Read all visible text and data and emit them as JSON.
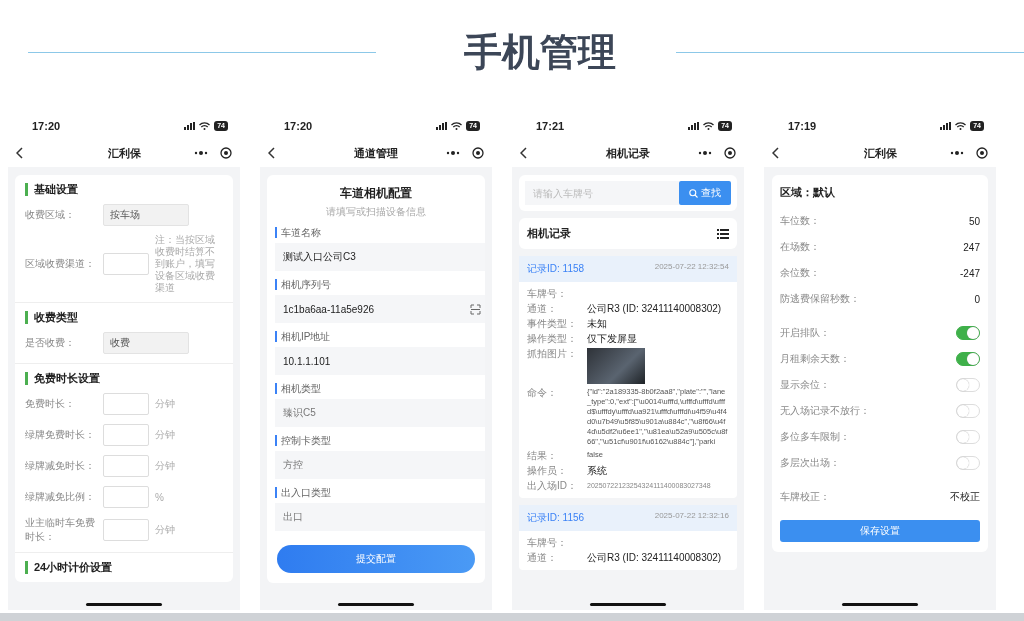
{
  "title": "手机管理",
  "phones": [
    {
      "kind": "fee_settings",
      "time": "17:20",
      "battery": "74",
      "nav_title": "汇利保",
      "sections": [
        {
          "title": "基础设置",
          "rows": [
            {
              "kind": "select",
              "label": "收费区域：",
              "value": "按车场"
            },
            {
              "kind": "input",
              "label": "区域收费渠道：",
              "note": "注：当按区域收费时结算不到账户，填写设备区域收费渠道"
            }
          ]
        },
        {
          "title": "收费类型",
          "rows": [
            {
              "kind": "select",
              "label": "是否收费：",
              "value": "收费"
            }
          ]
        },
        {
          "title": "免费时长设置",
          "rows": [
            {
              "kind": "input",
              "label": "免费时长：",
              "unit": "分钟"
            },
            {
              "kind": "input",
              "label": "绿牌免费时长：",
              "unit": "分钟"
            },
            {
              "kind": "input",
              "label": "绿牌减免时长：",
              "unit": "分钟"
            },
            {
              "kind": "input",
              "label": "绿牌减免比例：",
              "unit": "%"
            },
            {
              "kind": "input",
              "label": "业主临时车免费时长：",
              "unit": "分钟"
            }
          ]
        },
        {
          "title": "24小时计价设置"
        }
      ]
    },
    {
      "kind": "lane_camera_form",
      "time": "17:20",
      "battery": "74",
      "nav_title": "通道管理",
      "heading": "车道相机配置",
      "subheading": "请填写或扫描设备信息",
      "fields": [
        {
          "kind": "text",
          "label": "车道名称",
          "value": "测试入口公司C3"
        },
        {
          "kind": "scan",
          "label": "相机序列号",
          "value": "1c1ba6aa-11a5e926"
        },
        {
          "kind": "text",
          "label": "相机IP地址",
          "value": "10.1.1.101"
        },
        {
          "kind": "picker",
          "label": "相机类型",
          "value": "臻识C5"
        },
        {
          "kind": "picker",
          "label": "控制卡类型",
          "value": "方控"
        },
        {
          "kind": "picker",
          "label": "出入口类型",
          "value": "出口"
        }
      ],
      "button": "提交配置"
    },
    {
      "kind": "camera_records",
      "time": "17:21",
      "battery": "74",
      "nav_title": "相机记录",
      "search": {
        "placeholder": "请输入车牌号",
        "button": "查找"
      },
      "list_title": "相机记录",
      "records": [
        {
          "id": "记录ID: 1158",
          "time": "2025-07-22 12:32:54",
          "fields": [
            {
              "kind": "text",
              "label": "车牌号："
            },
            {
              "kind": "text",
              "label": "通道：",
              "value": "公司R3 (ID: 32411140008302)"
            },
            {
              "kind": "text",
              "label": "事件类型：",
              "value": "未知"
            },
            {
              "kind": "text",
              "label": "操作类型：",
              "value": "仅下发屏显"
            },
            {
              "kind": "photo",
              "label": "抓拍图片："
            },
            {
              "kind": "code",
              "label": "命令：",
              "value": "{\"id\":\"2a189335-8b0f2aa8\",\"plate\":\"\",\"lane_type\":0,\"ext\":[\"\\u0014\\ufffd,\\ufffd\\ufffd\\ufffd$\\ufffdy\\ufffd\\ua921\\ufffd\\ufffdi\\u4f59\\u4f4d0\\u7b49\\u5f85\\u901a\\u884c\",\"\\u8f66\\u4f4d\\u5df2\\u6ee1\",\"\\u81ea\\u52a9\\u505c\\u8f66\",\"\\u51cf\\u901f\\u6162\\u884c\"],\"parki"
            },
            {
              "kind": "code",
              "label": "结果：",
              "value": "false"
            },
            {
              "kind": "text",
              "label": "操作员：",
              "value": "系统"
            },
            {
              "kind": "muted",
              "label": "出入场ID：",
              "value": "20250722123254324111400083027348"
            }
          ]
        },
        {
          "id": "记录ID: 1156",
          "time": "2025-07-22 12:32:16",
          "fields": [
            {
              "kind": "text",
              "label": "车牌号："
            },
            {
              "kind": "text",
              "label": "通道：",
              "value": "公司R3 (ID: 32411140008302)"
            }
          ]
        }
      ]
    },
    {
      "kind": "area_settings",
      "time": "17:19",
      "battery": "74",
      "nav_title": "汇利保",
      "heading": "区域：默认",
      "items": [
        {
          "kind": "stat",
          "label": "车位数：",
          "value": "50"
        },
        {
          "kind": "stat",
          "label": "在场数：",
          "value": "247"
        },
        {
          "kind": "stat",
          "label": "余位数：",
          "value": "-247"
        },
        {
          "kind": "stat",
          "label": "防逃费保留秒数：",
          "value": "0"
        },
        {
          "kind": "toggle",
          "label": "开启排队：",
          "on": true
        },
        {
          "kind": "toggle",
          "label": "月租剩余天数：",
          "on": true
        },
        {
          "kind": "toggle",
          "label": "显示余位：",
          "on": false
        },
        {
          "kind": "toggle",
          "label": "无入场记录不放行：",
          "on": false
        },
        {
          "kind": "toggle",
          "label": "多位多车限制：",
          "on": false
        },
        {
          "kind": "toggle",
          "label": "多层次出场：",
          "on": false
        },
        {
          "kind": "option",
          "label": "车牌校正：",
          "value": "不校正"
        }
      ],
      "button": "保存设置"
    }
  ]
}
